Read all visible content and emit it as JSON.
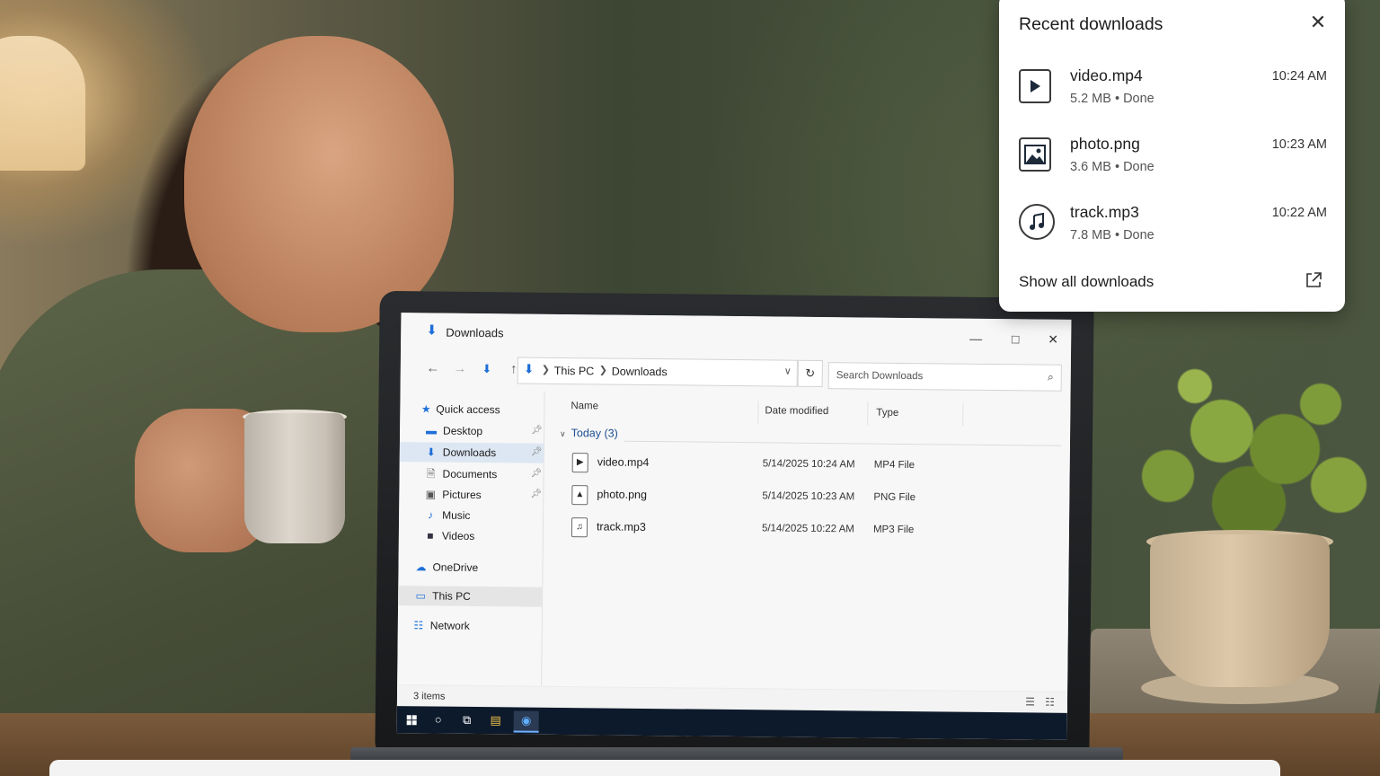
{
  "flyout": {
    "title": "Recent downloads",
    "items": [
      {
        "name": "video.mp4",
        "size": "5.2 MB",
        "sep": "•",
        "status": "Done",
        "time": "10:24 AM",
        "icon": "play-icon"
      },
      {
        "name": "photo.png",
        "size": "3.6 MB",
        "sep": "•",
        "status": "Done",
        "time": "10:23 AM",
        "icon": "image-icon"
      },
      {
        "name": "track.mp3",
        "size": "7.8 MB",
        "sep": "•",
        "status": "Done",
        "time": "10:22 AM",
        "icon": "music-note-icon"
      }
    ],
    "show_all": "Show all downloads"
  },
  "explorer": {
    "title": "Downloads",
    "breadcrumb": {
      "root": "This PC",
      "current": "Downloads"
    },
    "search_placeholder": "Search Downloads",
    "sidebar": {
      "quick_access": "Quick access",
      "items": [
        "Desktop",
        "Downloads",
        "Documents",
        "Pictures",
        "Music",
        "Videos"
      ],
      "onedrive": "OneDrive",
      "this_pc": "This PC",
      "network": "Network"
    },
    "columns": {
      "name": "Name",
      "date": "Date modified",
      "type": "Type"
    },
    "group": "Today (3)",
    "files": [
      {
        "name": "video.mp4",
        "date": "5/14/2025  10:24 AM",
        "type": "MP4 File"
      },
      {
        "name": "photo.png",
        "date": "5/14/2025  10:23 AM",
        "type": "PNG File"
      },
      {
        "name": "track.mp3",
        "date": "5/14/2025  10:22 AM",
        "type": "MP3 File"
      }
    ],
    "status": "3 items"
  },
  "colors": {
    "accent": "#1e6fd9",
    "taskbar": "#0d1a2b",
    "selection": "#dde7f3"
  }
}
